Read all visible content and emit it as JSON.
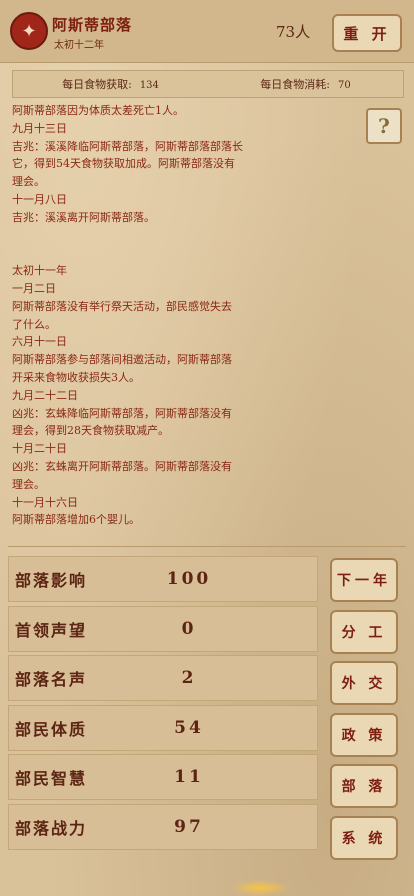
{
  "header": {
    "tribe_name": "阿斯蒂部落",
    "era": "太初十二年",
    "population": "73人",
    "restart_label": "重 开"
  },
  "food": {
    "gain_label": "每日食物获取:",
    "gain_value": "134",
    "consume_label": "每日食物消耗:",
    "consume_value": "70"
  },
  "log": [
    "阿斯蒂部落因为体质太差死亡1人。",
    "九月十三日",
    "吉兆：溪溪降临阿斯蒂部落，阿斯蒂部落部落长",
    "它，得到54天食物获取加成。阿斯蒂部落没有",
    "理会。",
    "十一月八日",
    "吉兆：溪溪离开阿斯蒂部落。",
    "",
    "",
    "太初十一年",
    "一月二日",
    "阿斯蒂部落没有举行祭天活动，部民感觉失去",
    "了什么。",
    "六月十一日",
    "阿斯蒂部落参与部落间相邀活动，阿斯蒂部落",
    "开采来食物收获损失3人。",
    "九月二十二日",
    "凶兆：玄蛛降临阿斯蒂部落，阿斯蒂部落没有",
    "理会，得到28天食物获取减产。",
    "十月二十日",
    "凶兆：玄蛛离开阿斯蒂部落。阿斯蒂部落没有",
    "理会。",
    "十一月十六日",
    "阿斯蒂部落增加6个婴儿。"
  ],
  "stats": [
    {
      "label": "部落影响",
      "value": "100"
    },
    {
      "label": "首领声望",
      "value": "0"
    },
    {
      "label": "部落名声",
      "value": "2"
    },
    {
      "label": "部民体质",
      "value": "54"
    },
    {
      "label": "部民智慧",
      "value": "11"
    },
    {
      "label": "部落战力",
      "value": "97"
    }
  ],
  "actions": [
    "下一年",
    "分 工",
    "外 交",
    "政 策",
    "部 落",
    "系 统"
  ],
  "icons": {
    "emblem": "tribe-emblem-icon",
    "help": "question-mark-icon"
  },
  "colors": {
    "background": "#d9c19a",
    "text": "#7a2a12",
    "emblem": "#a1261a"
  }
}
